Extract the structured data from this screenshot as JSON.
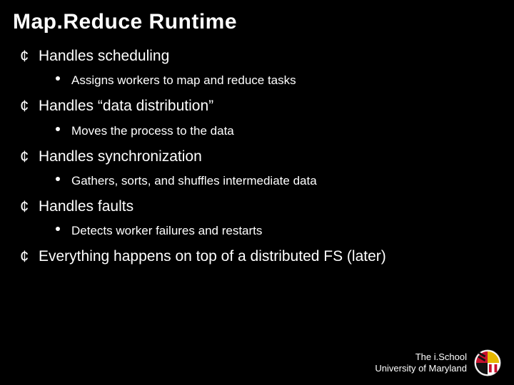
{
  "title": "Map.Reduce Runtime",
  "bullets": {
    "b0": {
      "text": "Handles scheduling",
      "sub": "Assigns workers to map and reduce tasks"
    },
    "b1": {
      "text": "Handles “data distribution”",
      "sub": "Moves the process to the data"
    },
    "b2": {
      "text": "Handles synchronization",
      "sub": "Gathers, sorts, and shuffles intermediate data"
    },
    "b3": {
      "text": "Handles faults",
      "sub": "Detects worker failures and restarts"
    },
    "b4": {
      "text": "Everything happens on top of a distributed FS (later)"
    }
  },
  "footer": {
    "line1": "The i.School",
    "line2": "University of Maryland"
  }
}
